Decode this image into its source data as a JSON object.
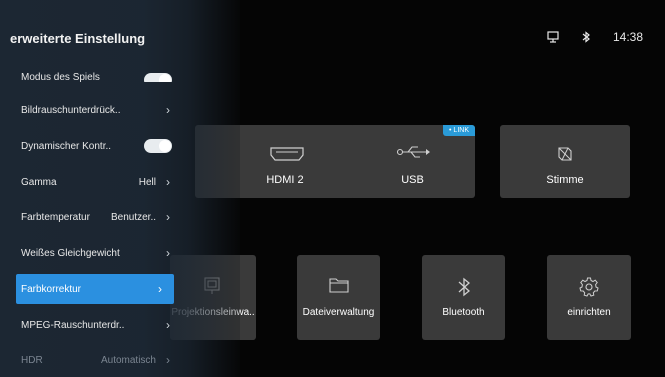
{
  "status": {
    "time": "14:38",
    "network_icon": "ethernet-icon",
    "bluetooth_icon": "bluetooth-icon"
  },
  "tiles": {
    "hdmi": {
      "label": "HDMI 2",
      "icon": "hdmi-icon"
    },
    "usb": {
      "label": "USB",
      "badge": "• LINK",
      "icon": "usb-icon"
    },
    "stimme": {
      "label": "Stimme",
      "icon": "voice-icon"
    },
    "projection": {
      "label": "Projektionsleinwa..",
      "icon": "projection-icon"
    },
    "datei": {
      "label": "Dateiverwaltung",
      "icon": "folder-icon"
    },
    "bluetooth": {
      "label": "Bluetooth",
      "icon": "bluetooth-icon"
    },
    "einrichten": {
      "label": "einrichten",
      "icon": "gear-icon"
    }
  },
  "panel": {
    "title": "erweiterte Einstellung",
    "items": [
      {
        "label": "Modus des Spiels",
        "control": "toggle",
        "state": "on"
      },
      {
        "label": "Bildrauschunterdrück..",
        "control": "chevron"
      },
      {
        "label": "Dynamischer Kontr..",
        "control": "toggle",
        "state": "on"
      },
      {
        "label": "Gamma",
        "value": "Hell",
        "control": "chevron"
      },
      {
        "label": "Farbtemperatur",
        "value": "Benutzer..",
        "control": "chevron"
      },
      {
        "label": "Weißes Gleichgewicht",
        "control": "chevron"
      },
      {
        "label": "Farbkorrektur",
        "control": "chevron",
        "selected": true
      },
      {
        "label": "MPEG-Rauschunterdr..",
        "control": "chevron"
      },
      {
        "label": "HDR",
        "value": "Automatisch",
        "control": "chevron",
        "disabled": true
      }
    ]
  },
  "colors": {
    "accent": "#2b90e0",
    "panel": "#1c2733",
    "tile": "#3a3a3a",
    "badge": "#2a9bd8"
  }
}
